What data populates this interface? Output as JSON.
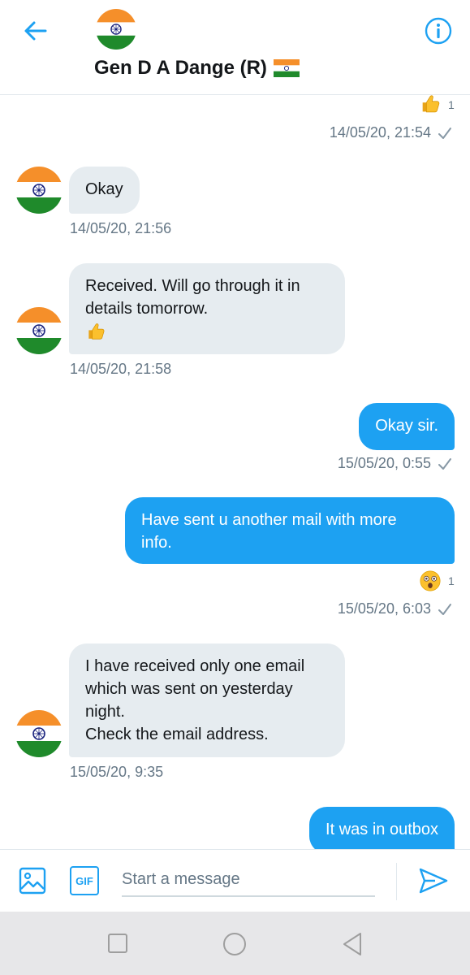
{
  "header": {
    "title": "Gen D A Dange (R)",
    "back_icon": "arrow-left-icon",
    "info_icon": "info-circle-icon",
    "avatar_icon": "india-flag-avatar",
    "title_emoji": "india-flag-emoji"
  },
  "colors": {
    "accent": "#1da1f2",
    "incoming_bubble": "#e6ecf0",
    "timestamp": "#657786",
    "saffron": "#ff9933",
    "green": "#138808",
    "chakra": "#000080"
  },
  "messages": [
    {
      "id": "m0",
      "direction": "out",
      "reaction": {
        "emoji": "thumbs-up",
        "count": "1"
      },
      "timestamp": "14/05/20, 21:54",
      "status": "sent-check-icon"
    },
    {
      "id": "m1",
      "direction": "in",
      "lines": [
        "Okay"
      ],
      "timestamp": "14/05/20, 21:56"
    },
    {
      "id": "m2",
      "direction": "in",
      "lines": [
        "Received. Will go through it in",
        "details tomorrow."
      ],
      "trailing_emoji": "thumbs-up",
      "timestamp": "14/05/20, 21:58"
    },
    {
      "id": "m3",
      "direction": "out",
      "lines": [
        "Okay sir."
      ],
      "timestamp": "15/05/20, 0:55",
      "status": "sent-check-icon"
    },
    {
      "id": "m4",
      "direction": "out",
      "lines": [
        "Have sent u another mail with more",
        "info."
      ],
      "reaction": {
        "emoji": "astonished-face",
        "count": "1"
      },
      "timestamp": "15/05/20, 6:03",
      "status": "sent-check-icon"
    },
    {
      "id": "m5",
      "direction": "in",
      "lines": [
        "I have received only one email",
        "which was sent on yesterday",
        "night.",
        "Check the email address."
      ],
      "timestamp": "15/05/20, 9:35"
    },
    {
      "id": "m6",
      "direction": "out",
      "lines": [
        "It was in outbox"
      ]
    }
  ],
  "composer": {
    "placeholder": "Start a message",
    "value": "",
    "media_icon": "image-icon",
    "gif_icon": "gif-icon",
    "gif_label": "GIF",
    "send_icon": "send-icon"
  },
  "navbar": {
    "recents_icon": "square-icon",
    "home_icon": "circle-icon",
    "back_icon": "triangle-back-icon"
  }
}
